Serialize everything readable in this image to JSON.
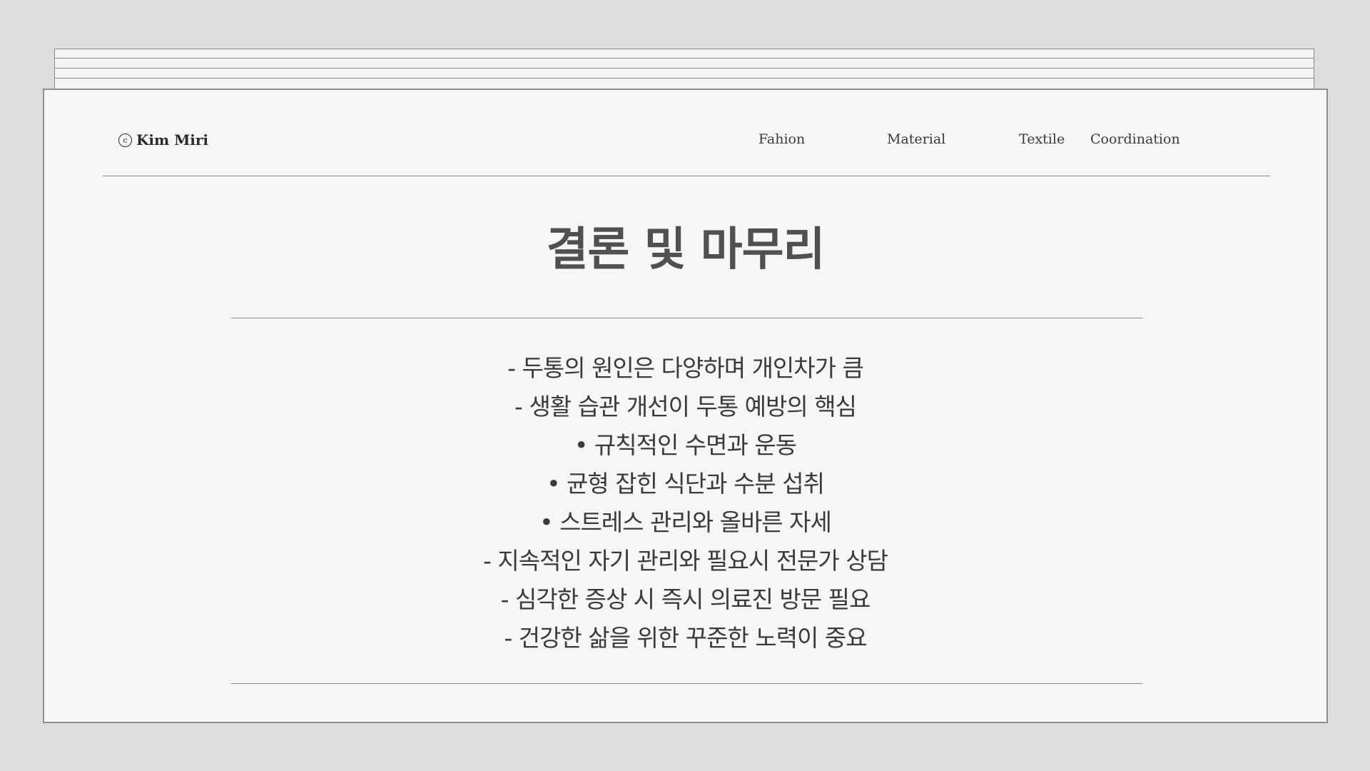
{
  "logo": {
    "symbol": "c",
    "text": "Kim Miri"
  },
  "nav": [
    {
      "label": "Fahion"
    },
    {
      "label": "Material"
    },
    {
      "label": "Textile"
    },
    {
      "label": "Coordination"
    }
  ],
  "title": "결론 및 마무리",
  "lines": [
    "- 두통의 원인은 다양하며 개인차가 큼",
    "- 생활 습관 개선이 두통 예방의 핵심",
    "• 규칙적인 수면과 운동",
    "• 균형 잡힌 식단과 수분 섭취",
    "• 스트레스 관리와 올바른 자세",
    "- 지속적인 자기 관리와 필요시 전문가 상담",
    "- 심각한 증상 시 즉시 의료진 방문 필요",
    "- 건강한 삶을 위한 꾸준한 노력이 중요"
  ]
}
